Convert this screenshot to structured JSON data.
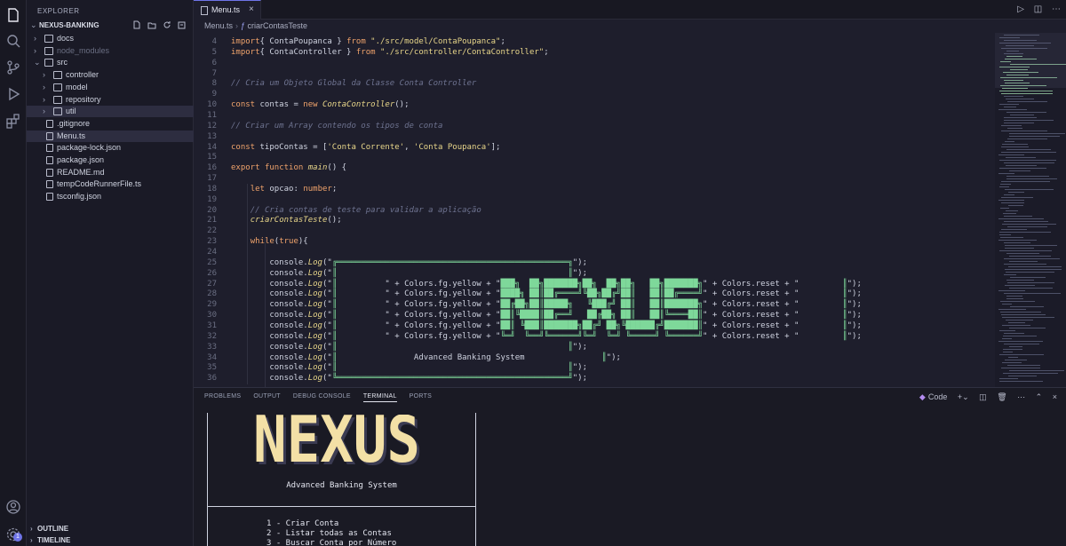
{
  "explorer": {
    "title": "EXPLORER",
    "root": "NEXUS-BANKING",
    "items": [
      {
        "label": "docs",
        "kind": "folder",
        "open": false
      },
      {
        "label": "node_modules",
        "kind": "folder",
        "open": false
      },
      {
        "label": "src",
        "kind": "folder",
        "open": true
      },
      {
        "label": "controller",
        "kind": "folder",
        "open": false
      },
      {
        "label": "model",
        "kind": "folder",
        "open": false
      },
      {
        "label": "repository",
        "kind": "folder",
        "open": false
      },
      {
        "label": "util",
        "kind": "folder",
        "open": false
      },
      {
        "label": ".gitignore",
        "kind": "file"
      },
      {
        "label": "Menu.ts",
        "kind": "file"
      },
      {
        "label": "package-lock.json",
        "kind": "file"
      },
      {
        "label": "package.json",
        "kind": "file"
      },
      {
        "label": "README.md",
        "kind": "file"
      },
      {
        "label": "tempCodeRunnerFile.ts",
        "kind": "file"
      },
      {
        "label": "tsconfig.json",
        "kind": "file"
      }
    ],
    "outline": "OUTLINE",
    "timeline": "TIMELINE"
  },
  "editor": {
    "tab_label": "Menu.ts",
    "breadcrumb": [
      "Menu.ts",
      "criarContasTeste"
    ],
    "lines": [
      {
        "n": "4",
        "parts": [
          [
            "kw",
            "import"
          ],
          [
            "",
            "{ ContaPoupanca } "
          ],
          [
            "kw",
            "from"
          ],
          [
            "",
            " "
          ],
          [
            "str",
            "\"./src/model/ContaPoupanca\""
          ],
          [
            "",
            ";"
          ]
        ]
      },
      {
        "n": "5",
        "parts": [
          [
            "kw",
            "import"
          ],
          [
            "",
            "{ ContaController } "
          ],
          [
            "kw",
            "from"
          ],
          [
            "",
            " "
          ],
          [
            "str",
            "\"./src/controller/ContaController\""
          ],
          [
            "",
            ";"
          ]
        ]
      },
      {
        "n": "6",
        "parts": []
      },
      {
        "n": "7",
        "parts": []
      },
      {
        "n": "8",
        "parts": [
          [
            "com",
            "// Cria um Objeto Global da Classe Conta Controller"
          ]
        ]
      },
      {
        "n": "9",
        "parts": []
      },
      {
        "n": "10",
        "parts": [
          [
            "kw",
            "const"
          ],
          [
            "",
            " contas = "
          ],
          [
            "kw",
            "new"
          ],
          [
            "",
            " "
          ],
          [
            "fn",
            "ContaController"
          ],
          [
            "",
            "();"
          ]
        ]
      },
      {
        "n": "11",
        "parts": []
      },
      {
        "n": "12",
        "parts": [
          [
            "com",
            "// Criar um Array contendo os tipos de conta"
          ]
        ]
      },
      {
        "n": "13",
        "parts": []
      },
      {
        "n": "14",
        "parts": [
          [
            "kw",
            "const"
          ],
          [
            "",
            " tipoContas = ["
          ],
          [
            "str",
            "'Conta Corrente'"
          ],
          [
            "",
            ", "
          ],
          [
            "str",
            "'Conta Poupanca'"
          ],
          [
            "",
            "];"
          ]
        ]
      },
      {
        "n": "15",
        "parts": []
      },
      {
        "n": "16",
        "parts": [
          [
            "kw",
            "export"
          ],
          [
            "",
            " "
          ],
          [
            "kw",
            "function"
          ],
          [
            "",
            " "
          ],
          [
            "fn",
            "main"
          ],
          [
            "",
            "() {"
          ]
        ]
      },
      {
        "n": "17",
        "parts": []
      },
      {
        "n": "18",
        "parts": [
          [
            "",
            "    "
          ],
          [
            "kw",
            "let"
          ],
          [
            "",
            " opcao: "
          ],
          [
            "kw",
            "number"
          ],
          [
            "",
            ";"
          ]
        ]
      },
      {
        "n": "19",
        "parts": []
      },
      {
        "n": "20",
        "parts": [
          [
            "",
            "    "
          ],
          [
            "com",
            "// Cria contas de teste para validar a aplicação"
          ]
        ]
      },
      {
        "n": "21",
        "parts": [
          [
            "",
            "    "
          ],
          [
            "fn",
            "criarContasTeste"
          ],
          [
            "",
            "();"
          ]
        ]
      },
      {
        "n": "22",
        "parts": []
      },
      {
        "n": "23",
        "parts": [
          [
            "",
            "    "
          ],
          [
            "kw",
            "while"
          ],
          [
            "",
            "("
          ],
          [
            "kw",
            "true"
          ],
          [
            "",
            "){"
          ]
        ]
      },
      {
        "n": "24",
        "parts": []
      },
      {
        "n": "25",
        "parts": [
          [
            "",
            "        console."
          ],
          [
            "fn",
            "Log"
          ],
          [
            "",
            "(\""
          ],
          [
            "grn",
            "╔════════════════════════════════════════════════╗"
          ],
          [
            "",
            "\");"
          ]
        ]
      },
      {
        "n": "26",
        "parts": [
          [
            "",
            "        console."
          ],
          [
            "fn",
            "Log"
          ],
          [
            "",
            "(\""
          ],
          [
            "grn",
            "║                                                ║"
          ],
          [
            "",
            "\");"
          ]
        ]
      },
      {
        "n": "27",
        "parts": [
          [
            "",
            "        console."
          ],
          [
            "fn",
            "Log"
          ],
          [
            "",
            "(\""
          ],
          [
            "grn",
            "║          "
          ],
          [
            "",
            "\" + Colors.fg.yellow + \""
          ],
          [
            "grn",
            "███╗  ██╗███████╗██╗  ██╗██╗   ██╗███████╗"
          ],
          [
            "",
            "\" + Colors.reset + \""
          ],
          [
            "grn",
            "         ║"
          ],
          [
            "",
            "\");"
          ]
        ]
      },
      {
        "n": "28",
        "parts": [
          [
            "",
            "        console."
          ],
          [
            "fn",
            "Log"
          ],
          [
            "",
            "(\""
          ],
          [
            "grn",
            "║          "
          ],
          [
            "",
            "\" + Colors.fg.yellow + \""
          ],
          [
            "grn",
            "████╗ ██║██╔════╝╚██╗██╔╝██║   ██║██╔════╝"
          ],
          [
            "",
            "\" + Colors.reset + \""
          ],
          [
            "grn",
            "         ║"
          ],
          [
            "",
            "\");"
          ]
        ]
      },
      {
        "n": "29",
        "parts": [
          [
            "",
            "        console."
          ],
          [
            "fn",
            "Log"
          ],
          [
            "",
            "(\""
          ],
          [
            "grn",
            "║          "
          ],
          [
            "",
            "\" + Colors.fg.yellow + \""
          ],
          [
            "grn",
            "██╔██╗██║█████╗   ╚███╔╝ ██║   ██║███████╗"
          ],
          [
            "",
            "\" + Colors.reset + \""
          ],
          [
            "grn",
            "         ║"
          ],
          [
            "",
            "\");"
          ]
        ]
      },
      {
        "n": "30",
        "parts": [
          [
            "",
            "        console."
          ],
          [
            "fn",
            "Log"
          ],
          [
            "",
            "(\""
          ],
          [
            "grn",
            "║          "
          ],
          [
            "",
            "\" + Colors.fg.yellow + \""
          ],
          [
            "grn",
            "██║╚████║██╔══╝   ██╔██╗ ██║   ██║╚════██║"
          ],
          [
            "",
            "\" + Colors.reset + \""
          ],
          [
            "grn",
            "         ║"
          ],
          [
            "",
            "\");"
          ]
        ]
      },
      {
        "n": "31",
        "parts": [
          [
            "",
            "        console."
          ],
          [
            "fn",
            "Log"
          ],
          [
            "",
            "(\""
          ],
          [
            "grn",
            "║          "
          ],
          [
            "",
            "\" + Colors.fg.yellow + \""
          ],
          [
            "grn",
            "██║ ╚███║███████╗██╔╝ ██╗╚██████╔╝███████║"
          ],
          [
            "",
            "\" + Colors.reset + \""
          ],
          [
            "grn",
            "         ║"
          ],
          [
            "",
            "\");"
          ]
        ]
      },
      {
        "n": "32",
        "parts": [
          [
            "",
            "        console."
          ],
          [
            "fn",
            "Log"
          ],
          [
            "",
            "(\""
          ],
          [
            "grn",
            "║          "
          ],
          [
            "",
            "\" + Colors.fg.yellow + \""
          ],
          [
            "grn",
            "╚═╝  ╚══╝╚══════╝╚═╝  ╚═╝ ╚═════╝ ╚══════╝"
          ],
          [
            "",
            "\" + Colors.reset + \""
          ],
          [
            "grn",
            "         ║"
          ],
          [
            "",
            "\");"
          ]
        ]
      },
      {
        "n": "33",
        "parts": [
          [
            "",
            "        console."
          ],
          [
            "fn",
            "Log"
          ],
          [
            "",
            "(\""
          ],
          [
            "grn",
            "║                                                ║"
          ],
          [
            "",
            "\");"
          ]
        ]
      },
      {
        "n": "34",
        "parts": [
          [
            "",
            "        console."
          ],
          [
            "fn",
            "Log"
          ],
          [
            "",
            "(\""
          ],
          [
            "grn",
            "║"
          ],
          [
            "",
            "                Advanced Banking System                "
          ],
          [
            "grn",
            "║"
          ],
          [
            "",
            "\");"
          ]
        ]
      },
      {
        "n": "35",
        "parts": [
          [
            "",
            "        console."
          ],
          [
            "fn",
            "Log"
          ],
          [
            "",
            "(\""
          ],
          [
            "grn",
            "║                                                ║"
          ],
          [
            "",
            "\");"
          ]
        ]
      },
      {
        "n": "36",
        "parts": [
          [
            "",
            "        console."
          ],
          [
            "fn",
            "Log"
          ],
          [
            "",
            "(\""
          ],
          [
            "grn",
            "╚════════════════════════════════════════════════╝"
          ],
          [
            "",
            "\");"
          ]
        ]
      }
    ]
  },
  "panel": {
    "tabs": [
      "PROBLEMS",
      "OUTPUT",
      "DEBUG CONSOLE",
      "TERMINAL",
      "PORTS"
    ],
    "active_tab": "TERMINAL",
    "terminal_name": "Code",
    "banner_logo": "NEXUS",
    "banner_subtitle": "Advanced Banking System",
    "menu": [
      "1 - Criar Conta",
      "2 - Listar todas as Contas",
      "3 - Buscar Conta por Número"
    ]
  },
  "colors": {
    "accent": "#6f74e8",
    "logo_fill": "#f3e0a6",
    "logo_shadow": "#3b3b52",
    "ascii_green": "#7ed89a"
  }
}
